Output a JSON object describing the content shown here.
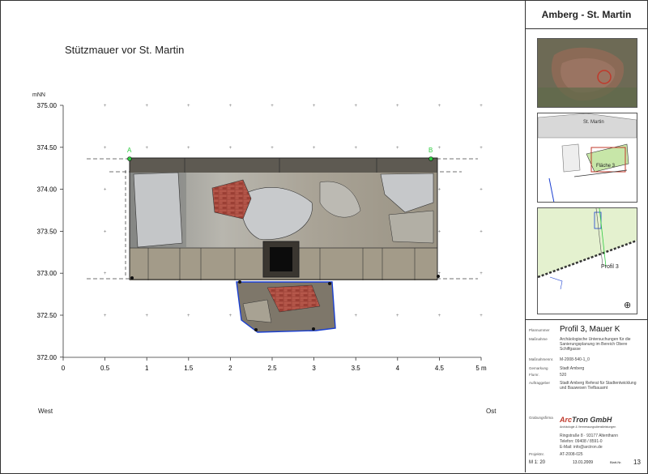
{
  "drawing": {
    "title": "Stützmauer vor St. Martin",
    "y_unit": "mNN",
    "x_unit": "m",
    "west_label": "West",
    "east_label": "Ost",
    "point_a": "A",
    "point_b": "B",
    "x_ticks": [
      "0",
      "0.5",
      "1",
      "1.5",
      "2",
      "2.5",
      "3",
      "3.5",
      "4",
      "4.5",
      "5"
    ],
    "y_ticks": [
      "375.00",
      "374.50",
      "374.00",
      "373.50",
      "373.00",
      "372.50",
      "372.00"
    ]
  },
  "sidebar": {
    "site_title": "Amberg - St. Martin",
    "plan_label_street": "St. Martin",
    "plan_label_area": "Fläche 3",
    "detail_label": "Profil 3"
  },
  "info": {
    "heading_label": "Plannummer",
    "heading": "Profil 3, Mauer K",
    "massnahme_label": "Maßnahme",
    "massnahme": "Archäologische Untersuchungen für die Sanierungsplanung im Bereich Obere Schiffgasse",
    "nr_label": "Maßnahmennr.",
    "nr": "M-2008-540-1_0",
    "gemarkung_label": "Gemarkung",
    "gemarkung": "Stadt Amberg",
    "flur_label": "Flurnr.",
    "flur": "520",
    "auftraggeber_label": "Auftraggeber",
    "auftraggeber": "Stadt Amberg Referat für Stadtentwicklung und Bauwesen Tiefbauamt",
    "firma_label": "Grabungsfirma",
    "company_accent": "Arc",
    "company_name": "Tron GmbH",
    "company_sub": "Archäologie & Vermessungsdienstleistungen",
    "address": "Ringstraße 8 · 93177 Altenthann",
    "phone": "Telefon: 09408 / 8591-0",
    "email": "E-Mail: info@arctron.de",
    "project_label": "Projektnr.",
    "project": "AT-2008-025",
    "scale": "M 1: 20",
    "date": "13.01.2009",
    "sheet_label": "Blatt-Nr.",
    "sheet": "13"
  },
  "colors": {
    "accent_red": "#c0392b",
    "point_green": "#2ecc40",
    "pit_outline": "#1a3fd0"
  }
}
